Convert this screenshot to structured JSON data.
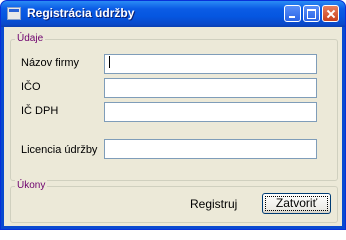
{
  "window": {
    "title": "Registrácia údržby",
    "icon": "app-form-icon"
  },
  "title_buttons": {
    "minimize": "minimize-icon",
    "maximize": "maximize-icon",
    "close": "close-icon"
  },
  "group_udaje": {
    "legend": "Údaje",
    "fields": [
      {
        "label": "Názov firmy",
        "value": ""
      },
      {
        "label": "IČO",
        "value": ""
      },
      {
        "label": "IČ DPH",
        "value": ""
      },
      {
        "label": "Licencia údržby",
        "value": ""
      }
    ]
  },
  "group_ukony": {
    "legend": "Úkony",
    "register_label": "Registruj",
    "close_label": "Zatvoriť"
  },
  "colors": {
    "title_bar": "#0556e0",
    "legend_text": "#6e006e",
    "dialog_bg": "#ece9d8"
  }
}
